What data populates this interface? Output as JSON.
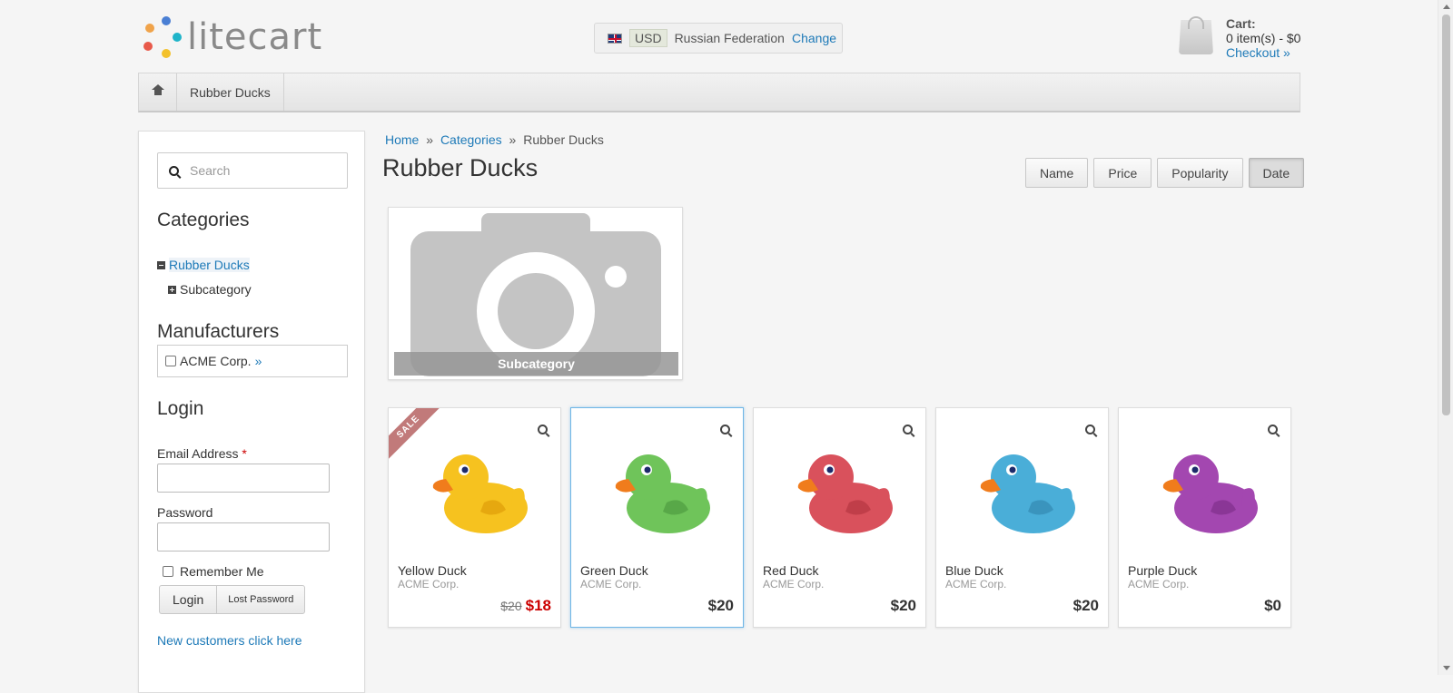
{
  "header": {
    "logo_text": "litecart",
    "logo_dot_colors": [
      "#4a7fd4",
      "#f0a34a",
      "#1fb4c9",
      "#e8594a",
      "#f3c12b",
      "#e84c4c"
    ],
    "region": {
      "flag": "uk-flag-icon",
      "currency": "USD",
      "country": "Russian Federation",
      "change_label": "Change"
    },
    "cart": {
      "title": "Cart:",
      "summary": "0 item(s) - $0",
      "checkout_label": "Checkout »"
    }
  },
  "nav": {
    "home_icon": "home-icon",
    "items": [
      {
        "label": "Rubber Ducks"
      }
    ]
  },
  "sidebar": {
    "search": {
      "placeholder": "Search"
    },
    "categories": {
      "title": "Categories",
      "items": [
        {
          "label": "Rubber Ducks",
          "expanded": true
        },
        {
          "label": "Subcategory",
          "expanded": false
        }
      ]
    },
    "manufacturers": {
      "title": "Manufacturers",
      "items": [
        {
          "label": "ACME Corp.",
          "more": "»"
        }
      ]
    },
    "login": {
      "title": "Login",
      "email_label": "Email Address",
      "required_mark": "*",
      "password_label": "Password",
      "remember_label": "Remember Me",
      "login_button": "Login",
      "lost_password_button": "Lost Password",
      "new_customers_link": "New customers click here"
    }
  },
  "main": {
    "breadcrumb": [
      {
        "label": "Home",
        "link": true
      },
      {
        "label": "Categories",
        "link": true
      },
      {
        "label": "Rubber Ducks",
        "link": false
      }
    ],
    "breadcrumb_sep": "»",
    "title": "Rubber Ducks",
    "sort": [
      {
        "label": "Name",
        "active": false
      },
      {
        "label": "Price",
        "active": false
      },
      {
        "label": "Popularity",
        "active": false
      },
      {
        "label": "Date",
        "active": true
      }
    ],
    "subcategory": {
      "label": "Subcategory"
    },
    "sale_badge": "SALE",
    "products": [
      {
        "name": "Yellow Duck",
        "manufacturer": "ACME Corp.",
        "old_price": "$20",
        "price": "$18",
        "on_sale": true,
        "color": "#f6c21f"
      },
      {
        "name": "Green Duck",
        "manufacturer": "ACME Corp.",
        "price": "$20",
        "on_sale": false,
        "color": "#6fc45a"
      },
      {
        "name": "Red Duck",
        "manufacturer": "ACME Corp.",
        "price": "$20",
        "on_sale": false,
        "color": "#d9515c"
      },
      {
        "name": "Blue Duck",
        "manufacturer": "ACME Corp.",
        "price": "$20",
        "on_sale": false,
        "color": "#4aaed8"
      },
      {
        "name": "Purple Duck",
        "manufacturer": "ACME Corp.",
        "price": "$0",
        "on_sale": false,
        "color": "#a347b0"
      }
    ]
  }
}
